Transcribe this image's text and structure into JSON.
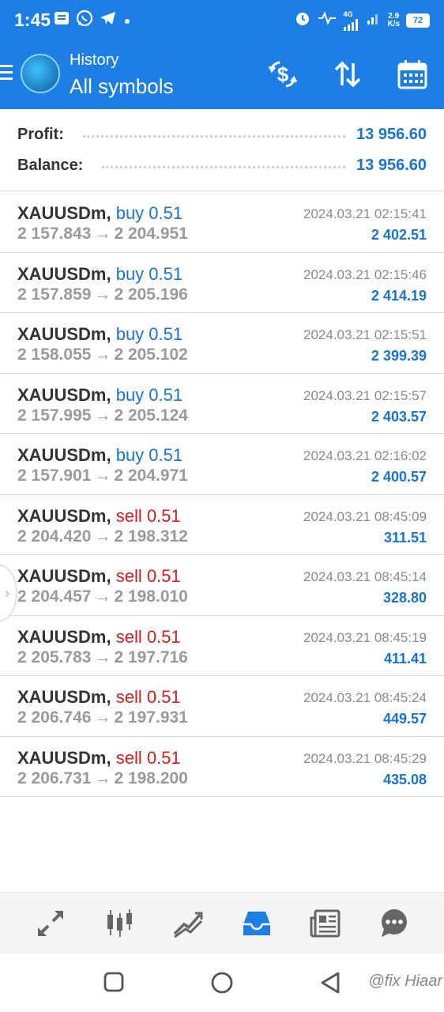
{
  "status_bar": {
    "time": "1:45",
    "net_gen": "4G",
    "net_speed_value": "2.9",
    "net_speed_unit": "K/s",
    "battery": "72"
  },
  "app_bar": {
    "subtitle": "History",
    "title": "All symbols"
  },
  "summary": {
    "profit_label": "Profit:",
    "profit_value": "13 956.60",
    "balance_label": "Balance:",
    "balance_value": "13 956.60"
  },
  "deals": [
    {
      "symbol": "XAUUSDm,",
      "side": "buy 0.51",
      "type": "buy",
      "open": "2 157.843",
      "close": "2 204.951",
      "time": "2024.03.21 02:15:41",
      "profit": "2 402.51"
    },
    {
      "symbol": "XAUUSDm,",
      "side": "buy 0.51",
      "type": "buy",
      "open": "2 157.859",
      "close": "2 205.196",
      "time": "2024.03.21 02:15:46",
      "profit": "2 414.19"
    },
    {
      "symbol": "XAUUSDm,",
      "side": "buy 0.51",
      "type": "buy",
      "open": "2 158.055",
      "close": "2 205.102",
      "time": "2024.03.21 02:15:51",
      "profit": "2 399.39"
    },
    {
      "symbol": "XAUUSDm,",
      "side": "buy 0.51",
      "type": "buy",
      "open": "2 157.995",
      "close": "2 205.124",
      "time": "2024.03.21 02:15:57",
      "profit": "2 403.57"
    },
    {
      "symbol": "XAUUSDm,",
      "side": "buy 0.51",
      "type": "buy",
      "open": "2 157.901",
      "close": "2 204.971",
      "time": "2024.03.21 02:16:02",
      "profit": "2 400.57"
    },
    {
      "symbol": "XAUUSDm,",
      "side": "sell 0.51",
      "type": "sell",
      "open": "2 204.420",
      "close": "2 198.312",
      "time": "2024.03.21 08:45:09",
      "profit": "311.51"
    },
    {
      "symbol": "XAUUSDm,",
      "side": "sell 0.51",
      "type": "sell",
      "open": "2 204.457",
      "close": "2 198.010",
      "time": "2024.03.21 08:45:14",
      "profit": "328.80"
    },
    {
      "symbol": "XAUUSDm,",
      "side": "sell 0.51",
      "type": "sell",
      "open": "2 205.783",
      "close": "2 197.716",
      "time": "2024.03.21 08:45:19",
      "profit": "411.41"
    },
    {
      "symbol": "XAUUSDm,",
      "side": "sell 0.51",
      "type": "sell",
      "open": "2 206.746",
      "close": "2 197.931",
      "time": "2024.03.21 08:45:24",
      "profit": "449.57"
    },
    {
      "symbol": "XAUUSDm,",
      "side": "sell 0.51",
      "type": "sell",
      "open": "2 206.731",
      "close": "2 198.200",
      "time": "2024.03.21 08:45:29",
      "profit": "435.08"
    }
  ],
  "arrow_glyph": "→",
  "watermark": "@fix Hiaar",
  "colors": {
    "app_bar": "#1d7fe6",
    "buy": "#1a73d1",
    "sell": "#d41f1f",
    "profit": "#1a73d1",
    "tab_active": "#1d7fe6"
  },
  "tabs": [
    "quotes-icon",
    "chart-icon",
    "trade-icon",
    "history-icon",
    "news-icon",
    "messages-icon"
  ],
  "active_tab": "history-icon"
}
